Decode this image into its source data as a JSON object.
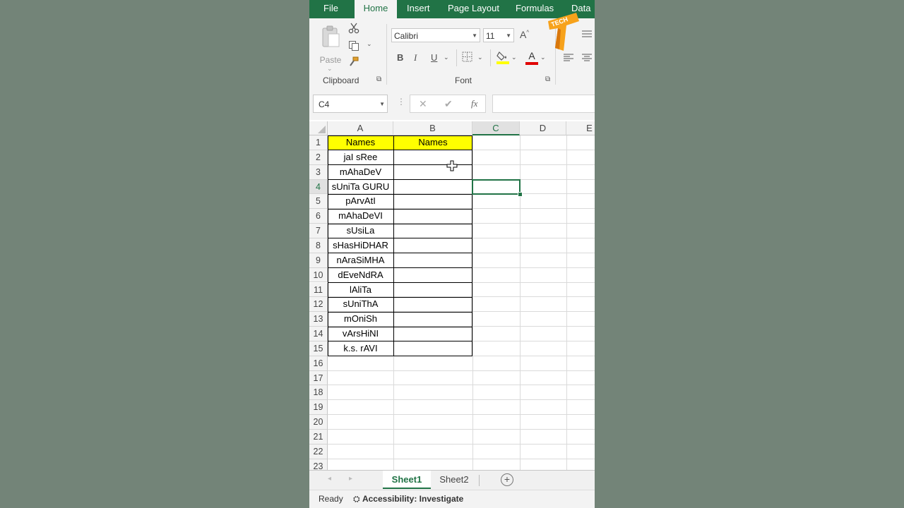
{
  "ribbon_tabs": {
    "file": "File",
    "home": "Home",
    "insert": "Insert",
    "page_layout": "Page Layout",
    "formulas": "Formulas",
    "data": "Data"
  },
  "clipboard": {
    "paste_label": "Paste",
    "group_label": "Clipboard"
  },
  "font": {
    "family": "Calibri",
    "size": "11",
    "group_label": "Font",
    "bold": "B",
    "italic": "I",
    "underline": "U",
    "grow": "A",
    "color_letter": "A"
  },
  "logo": {
    "text": "TECH"
  },
  "formula_bar": {
    "name_box": "C4",
    "cancel": "✕",
    "enter": "✔",
    "fx": "fx",
    "formula": ""
  },
  "columns": [
    "A",
    "B",
    "C",
    "D",
    "E"
  ],
  "rows": [
    "1",
    "2",
    "3",
    "4",
    "5",
    "6",
    "7",
    "8",
    "9",
    "10",
    "11",
    "12",
    "13",
    "14",
    "15",
    "16",
    "17",
    "18",
    "19",
    "20",
    "21",
    "22",
    "23"
  ],
  "cells": {
    "header_a": "Names",
    "header_b": "Names",
    "names": [
      "jaI sRee",
      "mAhaDeV",
      "sUniTa  GURU",
      "pArvAtI",
      "mAhaDeVI",
      "sUsiLa",
      "sHasHiDHAR",
      "nAraSiMHA",
      "dEveNdRA",
      "lAliTa",
      "sUniThA",
      "mOniSh",
      "vArsHiNI",
      "k.s. rAVI"
    ]
  },
  "sheet_tabs": {
    "sheet1": "Sheet1",
    "sheet2": "Sheet2",
    "add": "+"
  },
  "status": {
    "ready": "Ready",
    "accessibility": "Accessibility: Investigate"
  },
  "colors": {
    "excel_green": "#217346",
    "header_fill": "#ffff00",
    "font_color_bar": "#e00000",
    "fill_color_bar": "#ffff00"
  }
}
